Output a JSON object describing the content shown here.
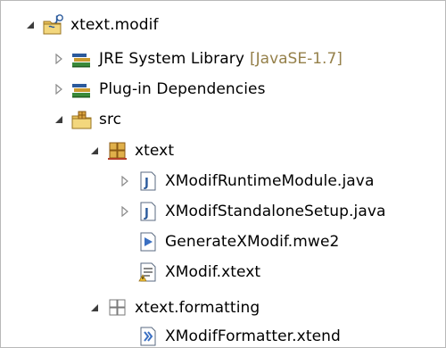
{
  "tree": {
    "project": {
      "label": "xtext.modif",
      "icon": "java-project-icon",
      "state": "expanded"
    },
    "jre": {
      "label": "JRE System Library",
      "decoration": "[JavaSE-1.7]",
      "icon": "library-icon",
      "state": "collapsed"
    },
    "plugins": {
      "label": "Plug-in Dependencies",
      "icon": "library-icon",
      "state": "collapsed"
    },
    "src": {
      "label": "src",
      "icon": "source-folder-icon",
      "state": "expanded"
    },
    "pkg_xtext": {
      "label": "xtext",
      "icon": "package-icon",
      "state": "expanded"
    },
    "runtime_module": {
      "label": "XModifRuntimeModule.java",
      "icon": "java-file-icon",
      "state": "collapsed"
    },
    "standalone_setup": {
      "label": "XModifStandaloneSetup.java",
      "icon": "java-file-icon",
      "state": "collapsed"
    },
    "mwe2": {
      "label": "GenerateXModif.mwe2",
      "icon": "mwe2-file-icon"
    },
    "xtext_file": {
      "label": "XModif.xtext",
      "icon": "xtext-file-icon"
    },
    "pkg_formatting": {
      "label": "xtext.formatting",
      "icon": "package-outline-icon",
      "state": "expanded"
    },
    "formatter": {
      "label": "XModifFormatter.xtend",
      "icon": "xtend-file-icon"
    }
  },
  "colors": {
    "decoration": "#95804a",
    "border": "#b9b9b9",
    "java_blue": "#2b5a9c"
  }
}
